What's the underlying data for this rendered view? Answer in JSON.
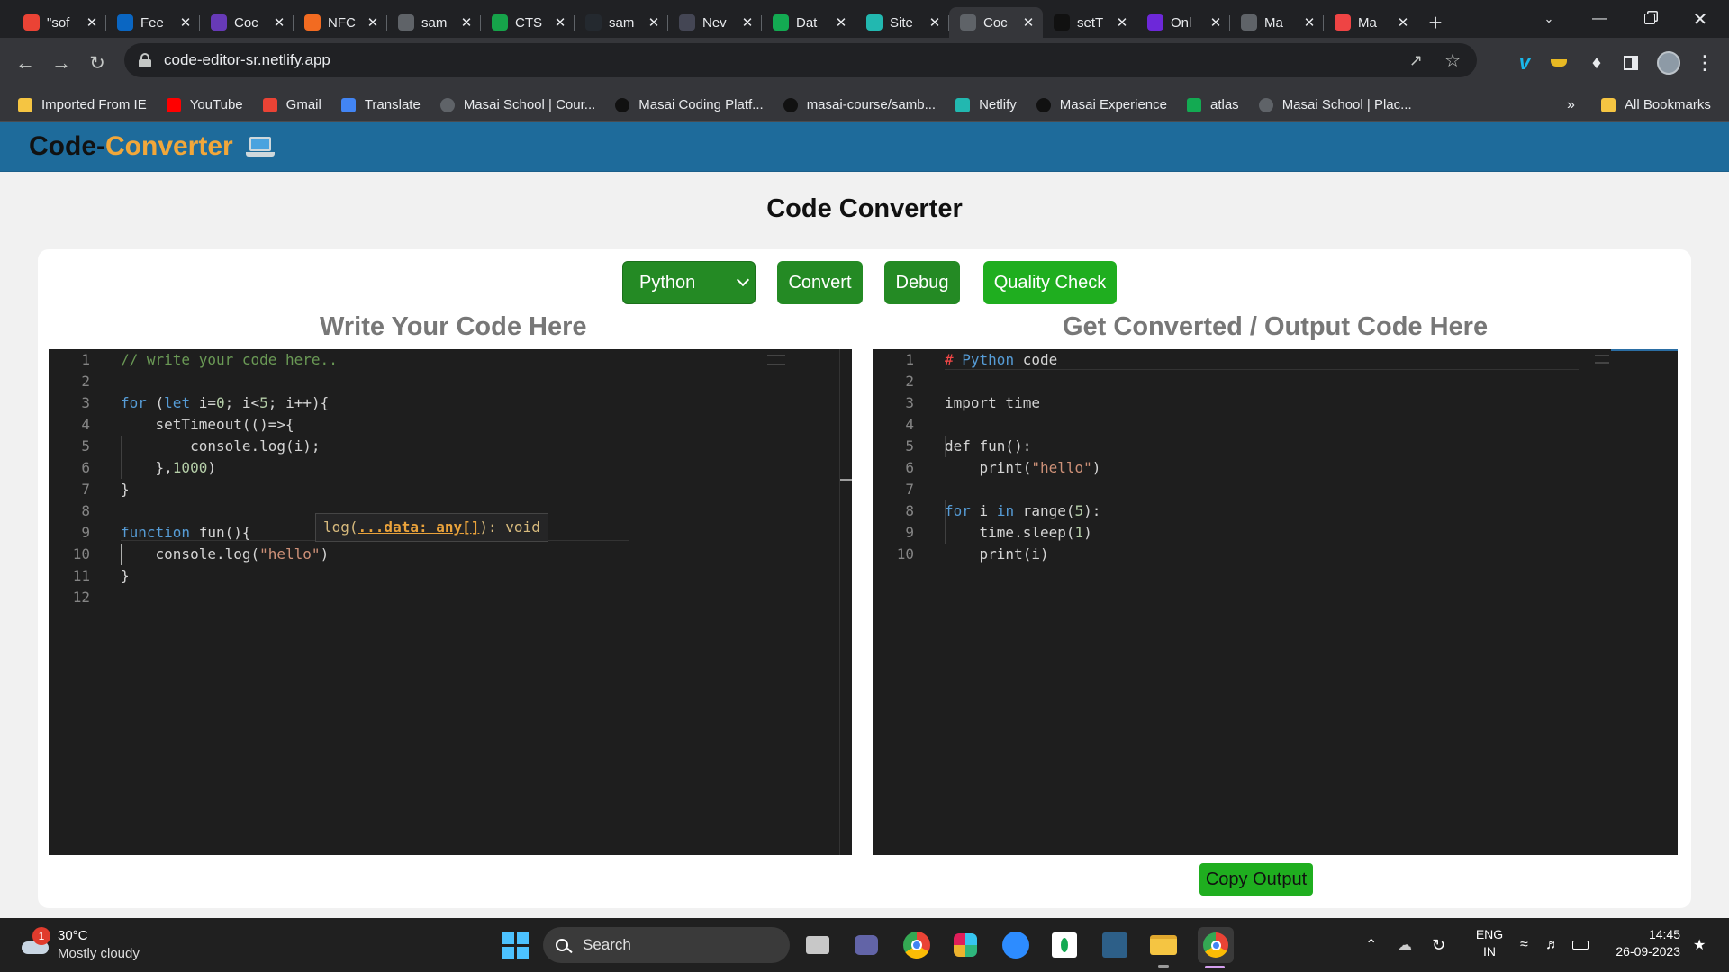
{
  "browser": {
    "tabs": [
      {
        "title": "\"sof",
        "icon": "gmail-icon",
        "color": "#ea4335"
      },
      {
        "title": "Fee",
        "icon": "linkedin-icon",
        "color": "#0a66c2"
      },
      {
        "title": "Coc",
        "icon": "forms-icon",
        "color": "#673ab7"
      },
      {
        "title": "NFC",
        "icon": "nfc-icon",
        "color": "#f26b21"
      },
      {
        "title": "sam",
        "icon": "globe-icon",
        "color": "#5f6368"
      },
      {
        "title": "CTS",
        "icon": "code-icon",
        "color": "#16a34a"
      },
      {
        "title": "sam",
        "icon": "github-icon",
        "color": "#24292f"
      },
      {
        "title": "Nev",
        "icon": "chatgpt-icon",
        "color": "#444654"
      },
      {
        "title": "Dat",
        "icon": "mongodb-icon",
        "color": "#13aa52"
      },
      {
        "title": "Site",
        "icon": "netlify-icon",
        "color": "#22b8b0"
      },
      {
        "title": "Coc",
        "icon": "globe-icon",
        "color": "#5f6368",
        "active": true
      },
      {
        "title": "setT",
        "icon": "medium-icon",
        "color": "#111111"
      },
      {
        "title": "Onl",
        "icon": "onlinegdb-icon",
        "color": "#6d28d9"
      },
      {
        "title": "Ma",
        "icon": "globe-icon",
        "color": "#5f6368"
      },
      {
        "title": "Ma",
        "icon": "masai-icon",
        "color": "#ef4444"
      }
    ],
    "url": "code-editor-sr.netlify.app",
    "bookmarks": [
      {
        "label": "Imported From IE",
        "icon": "folder-icon",
        "color": "#f5c542"
      },
      {
        "label": "YouTube",
        "icon": "youtube-icon",
        "color": "#ff0000"
      },
      {
        "label": "Gmail",
        "icon": "gmail-icon",
        "color": "#ea4335"
      },
      {
        "label": "Translate",
        "icon": "translate-icon",
        "color": "#4285f4"
      },
      {
        "label": "Masai School | Cour...",
        "icon": "globe-icon",
        "color": "#5f6368"
      },
      {
        "label": "Masai Coding Platf...",
        "icon": "masai-m-icon",
        "color": "#111111"
      },
      {
        "label": "masai-course/samb...",
        "icon": "github-icon",
        "color": "#111111"
      },
      {
        "label": "Netlify",
        "icon": "netlify-icon",
        "color": "#22b8b0"
      },
      {
        "label": "Masai Experience",
        "icon": "masai-m-icon",
        "color": "#111111"
      },
      {
        "label": "atlas",
        "icon": "mongodb-icon",
        "color": "#13aa52"
      },
      {
        "label": "Masai School | Plac...",
        "icon": "globe-icon",
        "color": "#5f6368"
      }
    ],
    "overflow_label": "»",
    "all_bookmarks": "All Bookmarks"
  },
  "app": {
    "brand_prefix": "Code-",
    "brand_accent": "Converter",
    "title": "Code Converter",
    "language": "Python",
    "buttons": {
      "convert": "Convert",
      "debug": "Debug",
      "quality": "Quality Check",
      "copy": "Copy Output"
    },
    "input_title": "Write Your Code Here",
    "output_title": "Get Converted / Output Code Here",
    "hover_tip": {
      "pre": "log(",
      "param": "...data: any[]",
      "post": "): void"
    },
    "input_lines": [
      "// write your code here..",
      "",
      "for (let i=0; i<5; i++){",
      "    setTimeout(()=>{",
      "        console.log(i);",
      "    },1000)",
      "}",
      "",
      "function fun(){",
      "    console.log(\"hello\")",
      "}",
      ""
    ],
    "output_lines": [
      "# Python code",
      "",
      "import time",
      "",
      "def fun():",
      "    print(\"hello\")",
      "",
      "for i in range(5):",
      "    time.sleep(1)",
      "    print(i)"
    ]
  },
  "taskbar": {
    "weather_temp": "30°C",
    "weather_desc": "Mostly cloudy",
    "weather_badge": "1",
    "search": "Search",
    "lang": "ENG",
    "region": "IN",
    "time": "14:45",
    "date": "26-09-2023"
  }
}
